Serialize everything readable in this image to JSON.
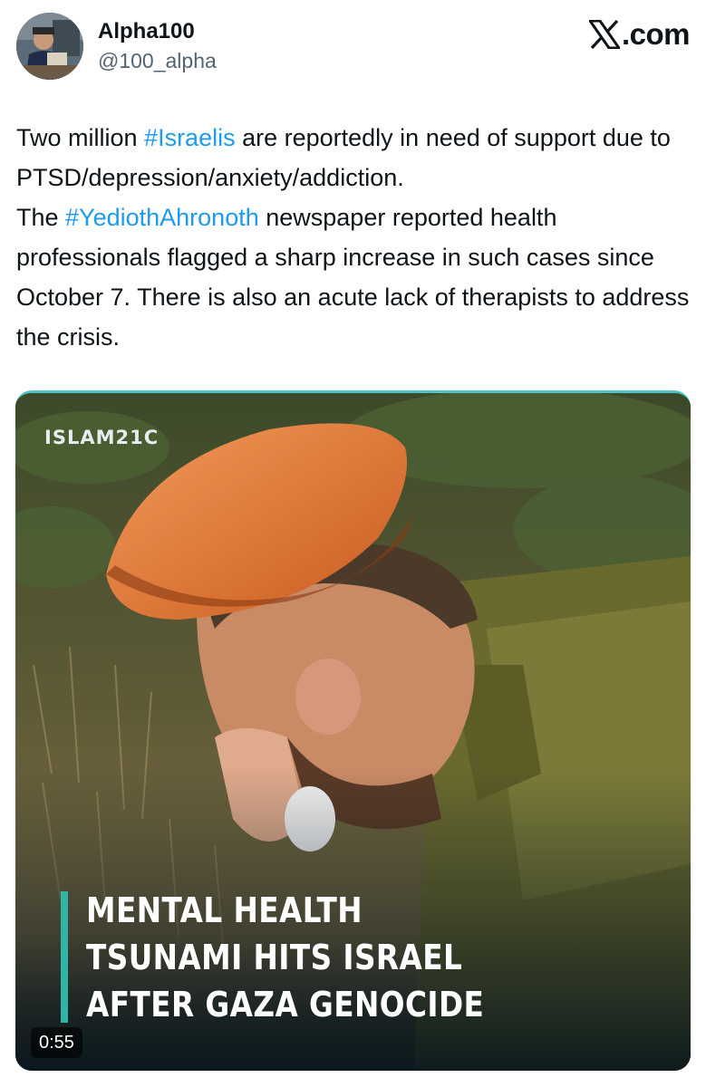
{
  "author": {
    "display_name": "Alpha100",
    "handle": "@100_alpha",
    "avatar_icon": "profile-photo"
  },
  "brand": {
    "logo_icon": "x-logo-icon",
    "label": ".com"
  },
  "tweet": {
    "parts": [
      {
        "text": "Two million "
      },
      {
        "text": "#Israelis",
        "hashtag": true
      },
      {
        "text": " are reportedly in need of support due to PTSD/depression/anxiety/addiction."
      },
      {
        "text": "The "
      },
      {
        "text": "#YediothAhronoth",
        "hashtag": true
      },
      {
        "text": " newspaper reported health professionals flagged a sharp increase in such cases since October 7. There is also an acute lack of therapists to address the crisis."
      }
    ]
  },
  "media": {
    "watermark": "ISLAM21C",
    "headline_lines": [
      "MENTAL HEALTH",
      "TSUNAMI HITS ISRAEL",
      "AFTER GAZA GENOCIDE"
    ],
    "duration": "0:55"
  },
  "colors": {
    "hashtag": "#1d9bf0",
    "accent_bar": "#2fb5a5",
    "media_top_border": "#4fc3c8",
    "text": "#0f1419",
    "muted": "#536471"
  }
}
